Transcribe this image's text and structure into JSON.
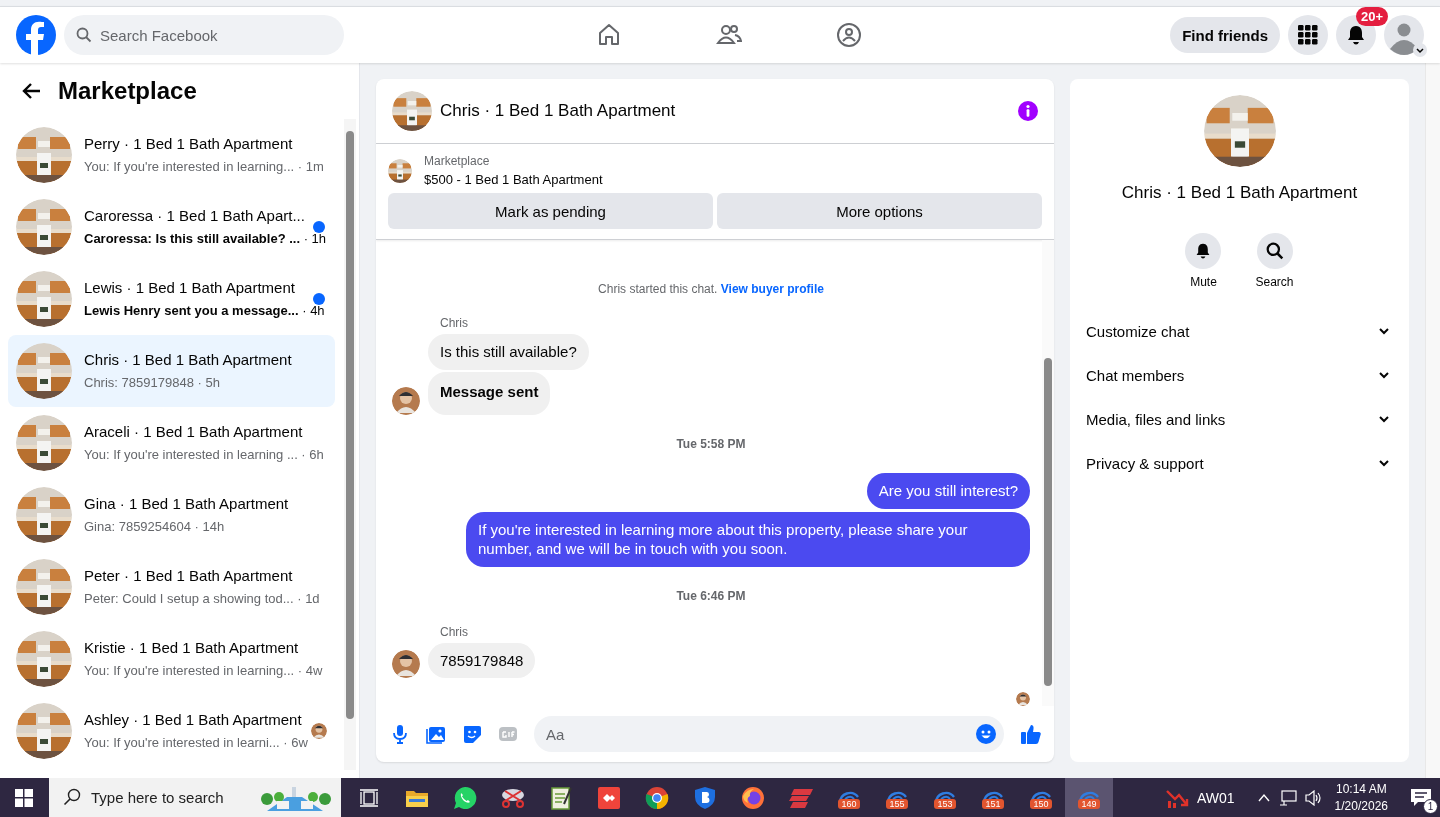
{
  "top_bar": {
    "search": {
      "placeholder": "Search Facebook"
    },
    "find_friends": "Find friends",
    "notification_badge": "20+"
  },
  "sidebar": {
    "title": "Marketplace",
    "conversations": [
      {
        "name": "Perry · 1 Bed 1 Bath Apartment",
        "preview": "You: If you're interested in learning...",
        "time": "· 1m",
        "unread": false,
        "selected": false,
        "seen": false
      },
      {
        "name": "Caroressa · 1 Bed 1 Bath Apart...",
        "preview": "Caroressa: Is this still available? ...",
        "time": "· 1h",
        "unread": true,
        "selected": false,
        "seen": false
      },
      {
        "name": "Lewis · 1 Bed 1 Bath Apartment",
        "preview": "Lewis Henry sent you a message...",
        "time": "· 4h",
        "unread": true,
        "selected": false,
        "seen": false
      },
      {
        "name": "Chris · 1 Bed 1 Bath Apartment",
        "preview": "Chris: 7859179848",
        "time": "· 5h",
        "unread": false,
        "selected": true,
        "seen": false
      },
      {
        "name": "Araceli · 1 Bed 1 Bath Apartment",
        "preview": "You: If you're interested in learning ...",
        "time": "· 6h",
        "unread": false,
        "selected": false,
        "seen": false
      },
      {
        "name": "Gina · 1 Bed 1 Bath Apartment",
        "preview": "Gina: 7859254604",
        "time": "· 14h",
        "unread": false,
        "selected": false,
        "seen": false
      },
      {
        "name": "Peter · 1 Bed 1 Bath Apartment",
        "preview": "Peter: Could I setup a showing tod...",
        "time": "· 1d",
        "unread": false,
        "selected": false,
        "seen": false
      },
      {
        "name": "Kristie · 1 Bed 1 Bath Apartment",
        "preview": "You: If you're interested in learning...",
        "time": "· 4w",
        "unread": false,
        "selected": false,
        "seen": false
      },
      {
        "name": "Ashley · 1 Bed 1 Bath Apartment",
        "preview": "You: If you're interested in learni...",
        "time": "· 6w",
        "unread": false,
        "selected": false,
        "seen": true
      }
    ]
  },
  "chat": {
    "title": "Chris · 1 Bed 1 Bath Apartment",
    "listing": {
      "label": "Marketplace",
      "title": "$500 - 1 Bed 1 Bath Apartment"
    },
    "actions": [
      "Mark as pending",
      "More options"
    ],
    "messages": [
      {
        "kind": "system",
        "text": "Chris started this chat.",
        "link": "View buyer profile"
      },
      {
        "kind": "incoming",
        "sender": "Chris",
        "bubbles": [
          {
            "text": "Is this still available?",
            "emphasis": false
          },
          {
            "text": "Message sent",
            "emphasis": true
          }
        ]
      },
      {
        "kind": "time",
        "text": "Tue 5:58 PM"
      },
      {
        "kind": "outgoing",
        "bubbles": [
          {
            "text": "Are you still interest?",
            "emphasis": false
          },
          {
            "text": "If you're interested in learning more about this property, please share your number, and we will be in touch with you soon.",
            "emphasis": false
          }
        ]
      },
      {
        "kind": "time",
        "text": "Tue 6:46 PM"
      },
      {
        "kind": "incoming",
        "sender": "Chris",
        "bubbles": [
          {
            "text": "7859179848",
            "emphasis": false
          }
        ]
      }
    ],
    "composer": {
      "placeholder": "Aa"
    }
  },
  "details": {
    "title": "Chris · 1 Bed 1 Bath Apartment",
    "actions": [
      {
        "kind": "mute",
        "label": "Mute"
      },
      {
        "kind": "search",
        "label": "Search"
      }
    ],
    "sections": [
      {
        "label": "Customize chat",
        "expanded": false
      },
      {
        "label": "Chat members",
        "expanded": false
      },
      {
        "label": "Media, files and links",
        "expanded": false
      },
      {
        "label": "Privacy & support",
        "expanded": false
      }
    ]
  },
  "taskbar": {
    "search_placeholder": "Type here to search",
    "apps": [
      {
        "kind": "taskview",
        "selected": false
      },
      {
        "kind": "folder",
        "selected": false
      },
      {
        "kind": "chat",
        "selected": false
      },
      {
        "kind": "snip",
        "selected": false
      },
      {
        "kind": "notepad",
        "selected": false
      },
      {
        "kind": "remote",
        "selected": false
      },
      {
        "kind": "browser",
        "selected": false
      },
      {
        "kind": "shield",
        "selected": false
      },
      {
        "kind": "firefox",
        "selected": false
      },
      {
        "kind": "vpn",
        "selected": false
      },
      {
        "kind": "session",
        "badge": "160",
        "selected": false
      },
      {
        "kind": "session",
        "badge": "155",
        "selected": false
      },
      {
        "kind": "session",
        "badge": "153",
        "selected": false
      },
      {
        "kind": "session",
        "badge": "151",
        "selected": false
      },
      {
        "kind": "session",
        "badge": "150",
        "selected": false
      },
      {
        "kind": "session",
        "badge": "149",
        "selected": true
      }
    ],
    "tray": {
      "label": "AW01",
      "time": "10:14 AM",
      "date": "1/20/2026",
      "notifications": "1"
    }
  }
}
